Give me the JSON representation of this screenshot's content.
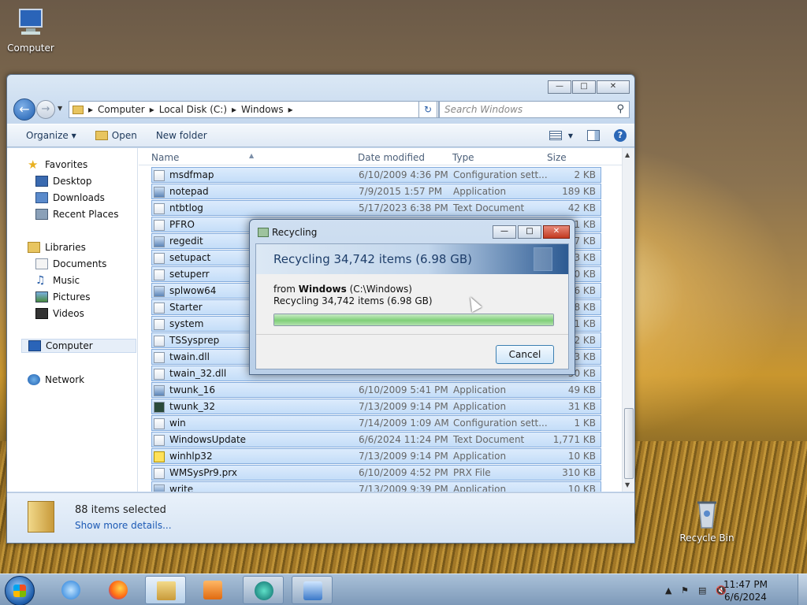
{
  "desktop": {
    "icons": [
      {
        "label": "Computer"
      },
      {
        "label": "Recycle Bin"
      }
    ]
  },
  "explorer": {
    "caption_buttons": [
      "minimize",
      "maximize",
      "close"
    ],
    "breadcrumb": [
      "Computer",
      "Local Disk (C:)",
      "Windows"
    ],
    "search_placeholder": "Search Windows",
    "toolbar": {
      "organize": "Organize",
      "open": "Open",
      "new_folder": "New folder"
    },
    "columns": {
      "name": "Name",
      "date": "Date modified",
      "type": "Type",
      "size": "Size"
    },
    "nav": {
      "favorites": "Favorites",
      "desktop": "Desktop",
      "downloads": "Downloads",
      "recent": "Recent Places",
      "libraries": "Libraries",
      "documents": "Documents",
      "music": "Music",
      "pictures": "Pictures",
      "videos": "Videos",
      "computer": "Computer",
      "network": "Network"
    },
    "files": [
      {
        "name": "msdfmap",
        "date": "6/10/2009 4:36 PM",
        "type": "Configuration sett...",
        "size": "2 KB",
        "icon": "config"
      },
      {
        "name": "notepad",
        "date": "7/9/2015 1:57 PM",
        "type": "Application",
        "size": "189 KB",
        "icon": "exe"
      },
      {
        "name": "ntbtlog",
        "date": "5/17/2023 6:38 PM",
        "type": "Text Document",
        "size": "42 KB",
        "icon": "txt"
      },
      {
        "name": "PFRO",
        "date": "",
        "type": "",
        "size": "01 KB",
        "icon": "txt"
      },
      {
        "name": "regedit",
        "date": "",
        "type": "",
        "size": "17 KB",
        "icon": "exe"
      },
      {
        "name": "setupact",
        "date": "",
        "type": "",
        "size": "23 KB",
        "icon": "txt"
      },
      {
        "name": "setuperr",
        "date": "",
        "type": "",
        "size": "0 KB",
        "icon": "txt"
      },
      {
        "name": "splwow64",
        "date": "",
        "type": "",
        "size": "66 KB",
        "icon": "exe"
      },
      {
        "name": "Starter",
        "date": "",
        "type": "",
        "size": "48 KB",
        "icon": "txt"
      },
      {
        "name": "system",
        "date": "",
        "type": "",
        "size": "1 KB",
        "icon": "config"
      },
      {
        "name": "TSSysprep",
        "date": "",
        "type": "",
        "size": "2 KB",
        "icon": "txt"
      },
      {
        "name": "twain.dll",
        "date": "",
        "type": "",
        "size": "93 KB",
        "icon": "dll"
      },
      {
        "name": "twain_32.dll",
        "date": "",
        "type": "",
        "size": "50 KB",
        "icon": "dll"
      },
      {
        "name": "twunk_16",
        "date": "6/10/2009 5:41 PM",
        "type": "Application",
        "size": "49 KB",
        "icon": "exe"
      },
      {
        "name": "twunk_32",
        "date": "7/13/2009 9:14 PM",
        "type": "Application",
        "size": "31 KB",
        "icon": "dark"
      },
      {
        "name": "win",
        "date": "7/14/2009 1:09 AM",
        "type": "Configuration sett...",
        "size": "1 KB",
        "icon": "config"
      },
      {
        "name": "WindowsUpdate",
        "date": "6/6/2024 11:24 PM",
        "type": "Text Document",
        "size": "1,771 KB",
        "icon": "txt"
      },
      {
        "name": "winhlp32",
        "date": "7/13/2009 9:14 PM",
        "type": "Application",
        "size": "10 KB",
        "icon": "help"
      },
      {
        "name": "WMSysPr9.prx",
        "date": "6/10/2009 4:52 PM",
        "type": "PRX File",
        "size": "310 KB",
        "icon": "txt"
      },
      {
        "name": "write",
        "date": "7/13/2009 9:39 PM",
        "type": "Application",
        "size": "10 KB",
        "icon": "exe"
      }
    ],
    "details": {
      "count": "88 items selected",
      "more": "Show more details..."
    }
  },
  "dialog": {
    "title": "Recycling",
    "banner": "Recycling 34,742 items (6.98 GB)",
    "from_prefix": "from",
    "from_name": "Windows",
    "from_path": "(C:\\Windows)",
    "status": "Recycling 34,742 items (6.98 GB)",
    "progress": 1.0,
    "cancel": "Cancel"
  },
  "taskbar": {
    "time": "11:47 PM",
    "date": "6/6/2024"
  }
}
